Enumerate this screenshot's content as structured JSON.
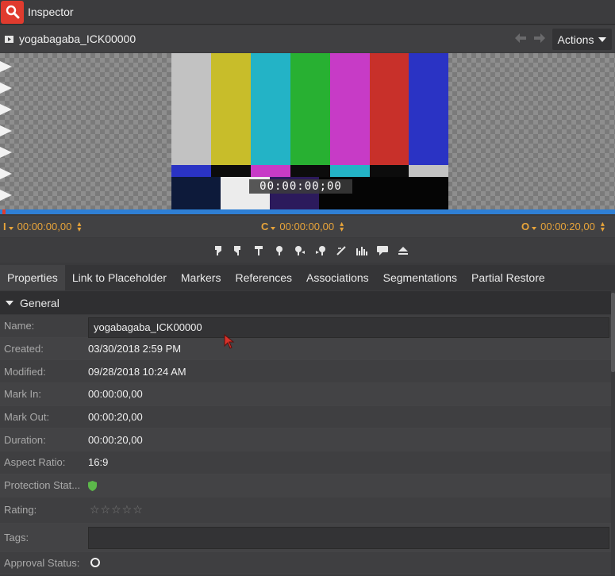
{
  "window": {
    "title": "Inspector"
  },
  "clip": {
    "name": "yogabagaba_ICK00000",
    "actions_label": "Actions"
  },
  "viewer": {
    "timecode_overlay": "00:00:00;00"
  },
  "timecodes": {
    "in_label": "I",
    "in_value": "00:00:00,00",
    "current_label": "C",
    "current_value": "00:00:00,00",
    "out_label": "O",
    "out_value": "00:00:20,00"
  },
  "toolbar": {
    "tools": [
      "mark-in-icon",
      "mark-out-icon",
      "add-marker-icon",
      "location-marker-icon",
      "prev-marker-icon",
      "next-marker-icon",
      "clear-marks-icon",
      "audio-levels-icon",
      "comment-icon",
      "eject-icon"
    ]
  },
  "tabs": [
    {
      "label": "Properties",
      "active": true
    },
    {
      "label": "Link to Placeholder"
    },
    {
      "label": "Markers"
    },
    {
      "label": "References"
    },
    {
      "label": "Associations"
    },
    {
      "label": "Segmentations"
    },
    {
      "label": "Partial Restore"
    }
  ],
  "section": {
    "label": "General"
  },
  "properties": {
    "name_label": "Name:",
    "name_value": "yogabagaba_ICK00000",
    "created_label": "Created:",
    "created_value": "03/30/2018 2:59 PM",
    "modified_label": "Modified:",
    "modified_value": "09/28/2018 10:24 AM",
    "mark_in_label": "Mark In:",
    "mark_in_value": "00:00:00,00",
    "mark_out_label": "Mark Out:",
    "mark_out_value": "00:00:20,00",
    "duration_label": "Duration:",
    "duration_value": "00:00:20,00",
    "aspect_label": "Aspect Ratio:",
    "aspect_value": "16:9",
    "protection_label": "Protection Stat...",
    "rating_label": "Rating:",
    "rating_stars": "☆☆☆☆☆",
    "tags_label": "Tags:",
    "tags_value": "",
    "approval_label": "Approval Status:"
  },
  "colors": {
    "accent_red": "#e03b2e",
    "timecode_orange": "#e8a43a",
    "scrub_blue": "#2f7fd4",
    "protection_green": "#5cb84a"
  }
}
